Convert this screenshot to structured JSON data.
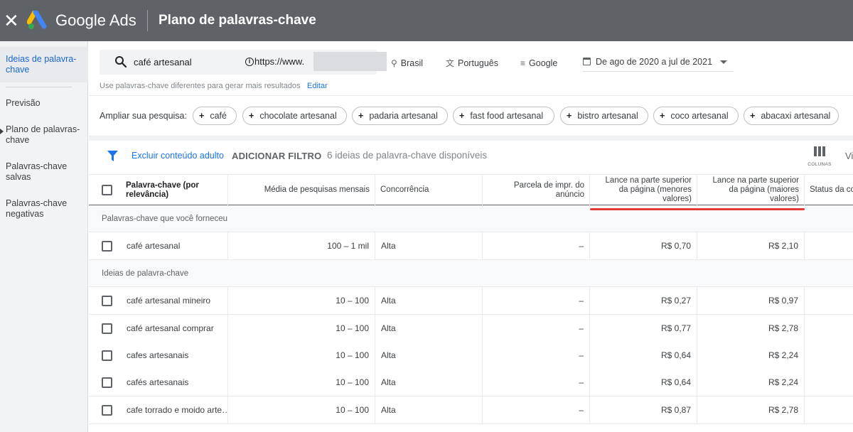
{
  "app": {
    "brand": "Google Ads",
    "title": "Plano de palavras-chave",
    "close": "✕"
  },
  "colors": {
    "accent_blue": "#1a73e8",
    "topbar": "#5f6368",
    "highlight_red": "#e53935"
  },
  "sidebar": {
    "items": [
      {
        "label": "Ideias de palavra-chave",
        "active": true
      },
      {
        "label": "Previsão"
      },
      {
        "label": "Plano de palavras-chave"
      },
      {
        "label": "Palavras-chave salvas"
      },
      {
        "label": "Palavras-chave negativas"
      }
    ]
  },
  "search": {
    "query": "café artesanal",
    "url_prefix": "https://www.",
    "location": "Brasil",
    "language": "Português",
    "network": "Google",
    "date_range": "De ago de 2020 a jul de 2021",
    "hint": "Use palavras-chave diferentes para gerar mais resultados",
    "edit": "Editar"
  },
  "expand": {
    "label": "Ampliar sua pesquisa:",
    "chips": [
      "café",
      "chocolate artesanal",
      "padaria artesanal",
      "fast food artesanal",
      "bistro artesanal",
      "coco artesanal",
      "abacaxi artesanal"
    ]
  },
  "toolbar": {
    "exclude_adult": "Excluir conteúdo adulto",
    "add_filter": "ADICIONAR FILTRO",
    "count": "6 ideias de palavra-chave disponíveis",
    "columns": "COLUNAS",
    "view": "Vi"
  },
  "table": {
    "headers": {
      "keyword": "Palavra-chave (por relevância)",
      "avg_searches": "Média de pesquisas mensais",
      "competition": "Concorrência",
      "impr_share": "Parcela de impr. do anúncio",
      "bid_low": "Lance na parte superior da página (menores valores)",
      "bid_high": "Lance na parte superior da página (maiores valores)",
      "status": "Status da co"
    },
    "group_provided": "Palavras-chave que você forneceu",
    "group_ideas": "Ideias de palavra-chave",
    "provided": [
      {
        "keyword": "café artesanal",
        "avg": "100 – 1 mil",
        "competition": "Alta",
        "impr": "–",
        "low": "R$ 0,70",
        "high": "R$ 2,10"
      }
    ],
    "ideas": [
      {
        "keyword": "café artesanal mineiro",
        "avg": "10 – 100",
        "competition": "Alta",
        "impr": "–",
        "low": "R$ 0,27",
        "high": "R$ 0,97"
      },
      {
        "keyword": "café artesanal comprar",
        "avg": "10 – 100",
        "competition": "Alta",
        "impr": "–",
        "low": "R$ 0,77",
        "high": "R$ 2,78"
      },
      {
        "keyword": "cafes artesanais",
        "avg": "10 – 100",
        "competition": "Alta",
        "impr": "–",
        "low": "R$ 0,64",
        "high": "R$ 2,24"
      },
      {
        "keyword": "cafés artesanais",
        "avg": "10 – 100",
        "competition": "Alta",
        "impr": "–",
        "low": "R$ 0,64",
        "high": "R$ 2,24"
      },
      {
        "keyword": "cafe torrado e moido arte…",
        "avg": "10 – 100",
        "competition": "Alta",
        "impr": "–",
        "low": "R$ 0,87",
        "high": "R$ 2,78"
      }
    ]
  }
}
